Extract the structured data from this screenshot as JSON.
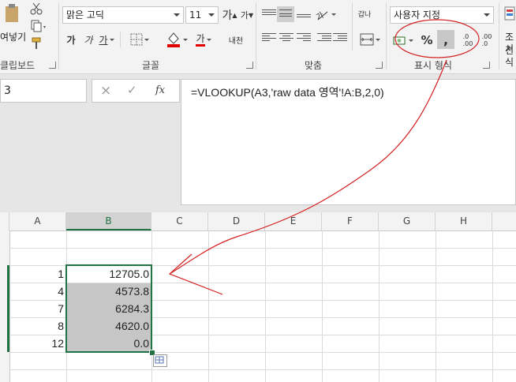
{
  "ribbon": {
    "clipboard": {
      "paste_label": "여넣기",
      "group_label": "클립보드"
    },
    "font": {
      "name": "맑은 고딕",
      "size": "11",
      "grow_label": "가",
      "shrink_label": "가",
      "bold": "가",
      "italic": "가",
      "underline": "가",
      "fontcolor_label": "가",
      "phonetic_label": "내천",
      "group_label": "글꼴"
    },
    "alignment": {
      "wrap_label": "갑나",
      "group_label": "맞춤"
    },
    "number": {
      "format": "사용자 지정",
      "percent": "%",
      "comma": ",",
      "inc_decimal": ".0\n.00",
      "dec_decimal": ".00\n.0",
      "group_label": "표시 형식"
    },
    "styles": {
      "cond_format_label": "조건",
      "format_label": "서식"
    },
    "colors": {
      "font_color_bar": "#e00000",
      "annotation_red": "#d42020"
    }
  },
  "formula_bar": {
    "name_box": "3",
    "formula": "=VLOOKUP(A3,'raw data 영역'!A:B,2,0)",
    "cancel_icon": "×",
    "enter_icon": "✓",
    "fx_label": "fx"
  },
  "sheet": {
    "columns": [
      "A",
      "B",
      "C",
      "D",
      "E",
      "F",
      "G",
      "H"
    ],
    "selected_column": "B",
    "rows": [
      {
        "a": "",
        "b": ""
      },
      {
        "a": "",
        "b": ""
      },
      {
        "a": "1",
        "b": "12705.0"
      },
      {
        "a": "4",
        "b": "4573.8"
      },
      {
        "a": "7",
        "b": "6284.3"
      },
      {
        "a": "8",
        "b": "4620.0"
      },
      {
        "a": "12",
        "b": "0.0"
      }
    ],
    "accent": "#217346",
    "selection_fill": "#c6c6c6"
  }
}
